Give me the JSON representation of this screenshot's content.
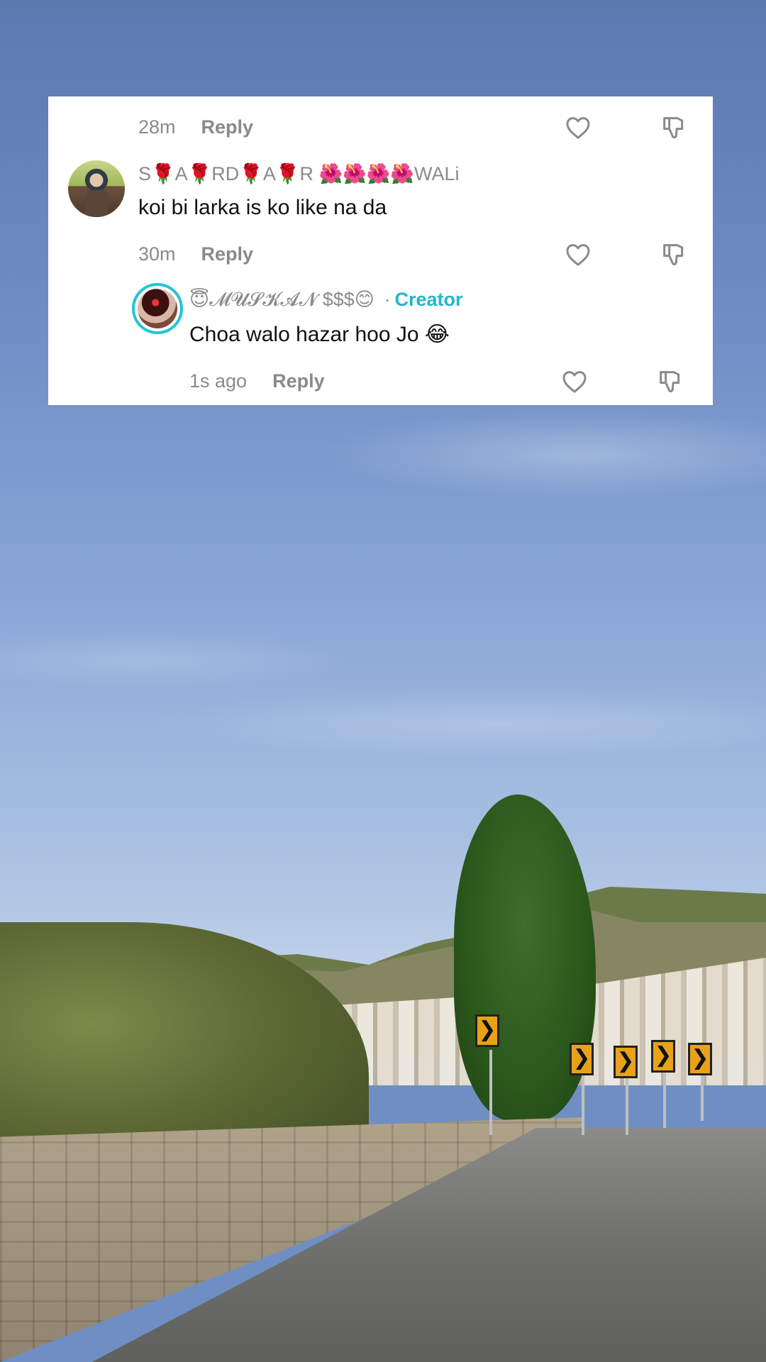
{
  "comments": [
    {
      "time": "28m",
      "reply_label": "Reply"
    },
    {
      "username": "S🌹A🌹RD🌹A🌹R 🌺🌺🌺🌺WALi",
      "text": "koi bi larka is ko like na da",
      "time": "30m",
      "reply_label": "Reply",
      "avatar_icon": "user-avatar-photo"
    },
    {
      "username": "😇𝓜𝓤𝓢𝓚𝓐𝓝 $$$😊",
      "separator": "·",
      "badge": "Creator",
      "text": "Choa walo hazar hoo Jo 😂",
      "time": "1s ago",
      "reply_label": "Reply",
      "avatar_icon": "creator-avatar-photo"
    }
  ],
  "icons": {
    "like": "heart-outline-icon",
    "dislike": "thumbs-down-outline-icon"
  },
  "colors": {
    "card_bg": "#ffffff",
    "meta_text": "#8a8a8a",
    "creator_badge": "#23b7c9",
    "comment_text": "#111111"
  },
  "road_signs": [
    "❯",
    "❯",
    "❯",
    "❯",
    "❯"
  ]
}
